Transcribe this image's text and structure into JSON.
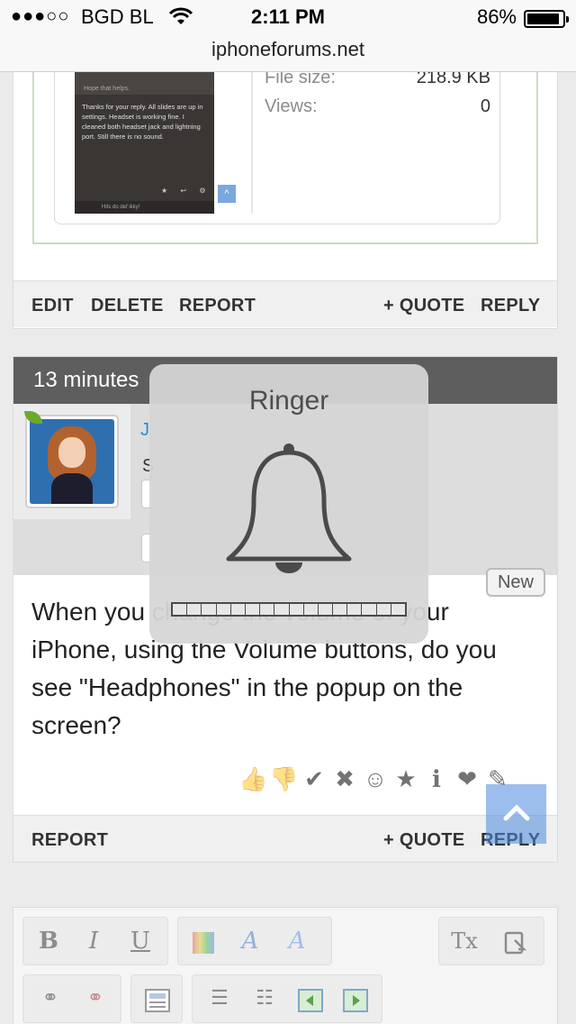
{
  "status_bar": {
    "signal": "●●●○○",
    "carrier": "BGD BL",
    "time": "2:11 PM",
    "battery_percent": "86%",
    "battery_level": 0.86,
    "url": "iphoneforums.net"
  },
  "post1": {
    "attachment": {
      "thumb_hope": "Hope that helps.",
      "thumb_text": "Thanks for your reply. All slides are up in settings. Headset is working fine. I cleaned both headset jack and lightning port. Still there is no sound.",
      "thumb_icons": "★ ↩ ⚙",
      "thumb_caption": "Hits do def ikky!",
      "thumb_scroll": "^",
      "file_size_label": "File size:",
      "file_size_value": "218.9 KB",
      "views_label": "Views:",
      "views_value": "0"
    },
    "actions": {
      "edit": "EDIT",
      "delete": "DELETE",
      "report": "REPORT",
      "quote": "+ QUOTE",
      "reply": "REPLY"
    }
  },
  "post2": {
    "time": "13 minutes",
    "author_initial": "J",
    "author_title_initial": "S",
    "new_badge": "New",
    "body": "When you change the volume of your iPhone, using the Volume buttons, do you see \"Headphones\" in the popup on the screen?",
    "reactions": [
      {
        "icon": "thumbs-up-icon",
        "glyph": "👍"
      },
      {
        "icon": "thumbs-down-icon",
        "glyph": "👎"
      },
      {
        "icon": "check-icon",
        "glyph": "✔"
      },
      {
        "icon": "cross-icon",
        "glyph": "✖"
      },
      {
        "icon": "smile-icon",
        "glyph": "☺"
      },
      {
        "icon": "star-icon",
        "glyph": "★"
      },
      {
        "icon": "info-icon",
        "glyph": "ℹ"
      },
      {
        "icon": "heart-icon",
        "glyph": "❤"
      },
      {
        "icon": "wrench-icon",
        "glyph": "✎"
      }
    ],
    "actions": {
      "report": "REPORT",
      "quote": "+ QUOTE",
      "reply": "REPLY"
    }
  },
  "editor": {
    "bold": "B",
    "italic": "I",
    "underline": "U",
    "clear_format": "Tx"
  },
  "ringer_hud": {
    "title": "Ringer",
    "volume_level": 0,
    "segments": 16
  },
  "colors": {
    "header_dark": "#5e5e5e",
    "link_blue": "#2a8ad6",
    "scroll_top_blue": "#4a89dc"
  }
}
